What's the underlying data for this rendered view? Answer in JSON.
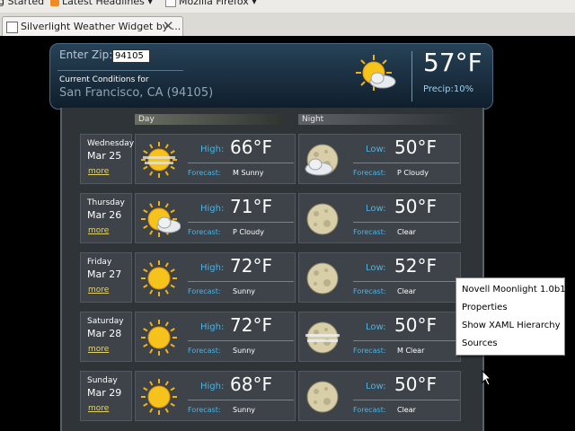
{
  "browser": {
    "bookmarks": [
      "g Started",
      "Latest Headlines",
      "Mozilla Firefox"
    ],
    "tab_title": "Silverlight Weather Widget by ..."
  },
  "widget": {
    "zip_label": "Enter Zip:",
    "zip_value": "94105",
    "current_label": "Current Conditions for",
    "location": "San Francisco, CA (94105)",
    "current_temp": "57°F",
    "precip_label": "Precip:",
    "precip_value": "10%",
    "day_header": "Day",
    "night_header": "Night",
    "high_label": "High:",
    "low_label": "Low:",
    "forecast_label": "Forecast:",
    "more_label": "more",
    "days": [
      {
        "dow": "Wednesday",
        "date": "Mar 25",
        "high": "66°F",
        "day_forecast": "M Sunny",
        "low": "50°F",
        "night_forecast": "P Cloudy",
        "day_icon": "sun-haze-icon",
        "night_icon": "moon-cloud-icon"
      },
      {
        "dow": "Thursday",
        "date": "Mar 26",
        "high": "71°F",
        "day_forecast": "P Cloudy",
        "low": "50°F",
        "night_forecast": "Clear",
        "day_icon": "sun-cloud-icon",
        "night_icon": "moon-icon"
      },
      {
        "dow": "Friday",
        "date": "Mar 27",
        "high": "72°F",
        "day_forecast": "Sunny",
        "low": "52°F",
        "night_forecast": "Clear",
        "day_icon": "sun-icon",
        "night_icon": "moon-icon"
      },
      {
        "dow": "Saturday",
        "date": "Mar 28",
        "high": "72°F",
        "day_forecast": "Sunny",
        "low": "50°F",
        "night_forecast": "M Clear",
        "day_icon": "sun-icon",
        "night_icon": "moon-haze-icon"
      },
      {
        "dow": "Sunday",
        "date": "Mar 29",
        "high": "68°F",
        "day_forecast": "Sunny",
        "low": "50°F",
        "night_forecast": "Clear",
        "day_icon": "sun-icon",
        "night_icon": "moon-icon"
      }
    ]
  },
  "context_menu": {
    "items": [
      "Novell Moonlight 1.0b1",
      "Properties",
      "Show XAML Hierarchy",
      "Sources"
    ]
  },
  "colors": {
    "accent_label": "#4fb2e2",
    "more_link": "#e3d26a",
    "header_bg": "#1c3245"
  }
}
